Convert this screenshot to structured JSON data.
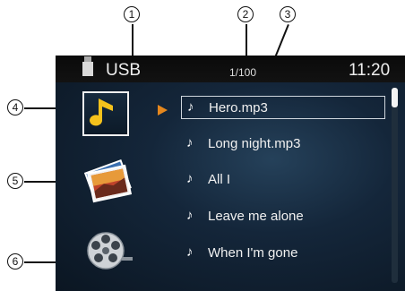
{
  "callouts": [
    "1",
    "2",
    "3",
    "4",
    "5",
    "6"
  ],
  "status_bar": {
    "source_label": "USB",
    "track_counter": "1/100",
    "clock": "11:20"
  },
  "sidebar": [
    {
      "mode": "music",
      "icon": "music-note-icon",
      "selected": true
    },
    {
      "mode": "photo",
      "icon": "photo-icon",
      "selected": false
    },
    {
      "mode": "video",
      "icon": "film-reel-icon",
      "selected": false
    }
  ],
  "tracks": [
    {
      "title": "Hero.mp3",
      "selected": true
    },
    {
      "title": "Long night.mp3",
      "selected": false
    },
    {
      "title": "All I",
      "selected": false
    },
    {
      "title": "Leave me alone",
      "selected": false
    },
    {
      "title": "When I'm gone",
      "selected": false
    }
  ],
  "colors": {
    "accent": "#e5871d",
    "music_icon": "#f5c21c",
    "screen_bg": "#14263a",
    "status_bar": "#0a0a0a"
  }
}
